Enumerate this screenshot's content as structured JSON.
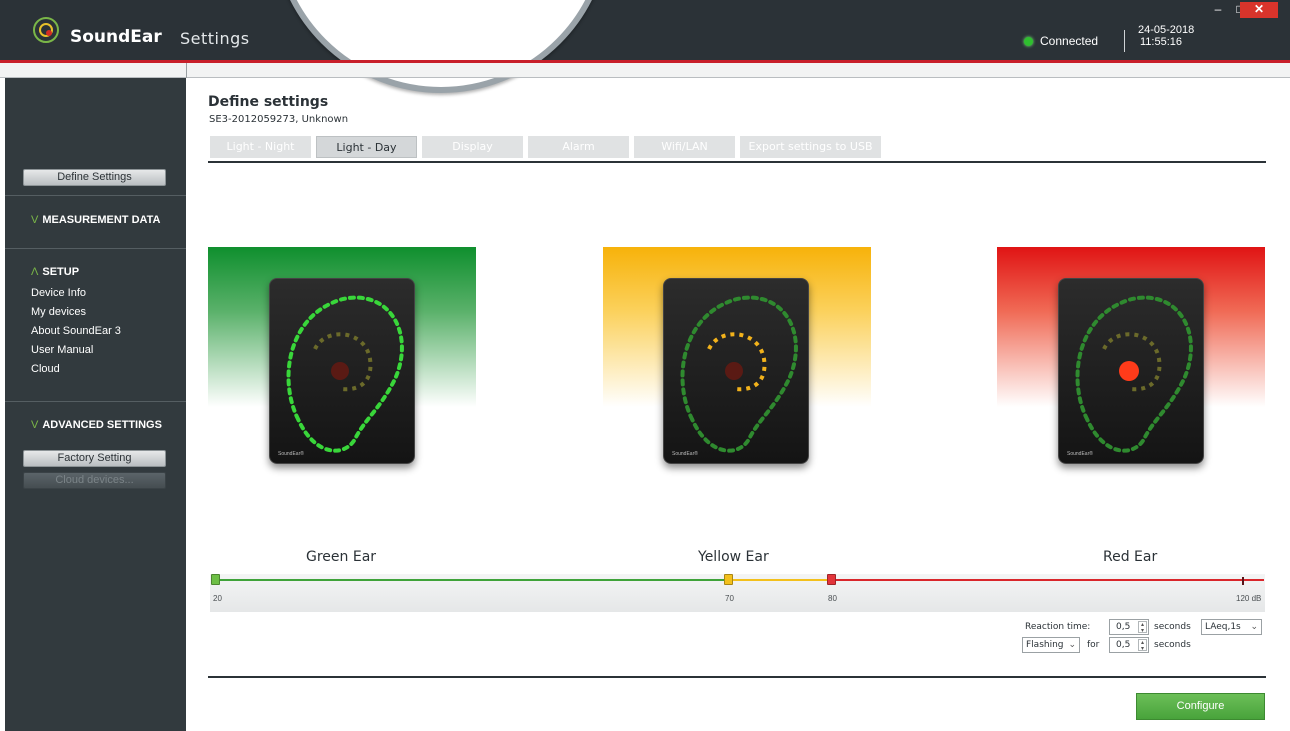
{
  "app": {
    "brand": "SoundEar",
    "brand_sub": "Settings",
    "status": "Connected",
    "date": "24-05-2018",
    "time": "11:55:16",
    "accent_color": "#c8202a"
  },
  "window_controls": {
    "minimize": "–",
    "maximize": "□",
    "close": "✕"
  },
  "sidebar": {
    "define_settings_button": "Define Settings",
    "measurement_data": {
      "chevron": "V",
      "label": "MEASUREMENT DATA"
    },
    "setup": {
      "chevron": "Λ",
      "label": "SETUP",
      "items": [
        "Device Info",
        "My devices",
        "About SoundEar 3",
        "User Manual",
        "Cloud"
      ]
    },
    "advanced_settings": {
      "chevron": "V",
      "label": "ADVANCED SETTINGS"
    },
    "factory_setting_button": "Factory Setting",
    "cloud_devices_button": "Cloud devices..."
  },
  "main": {
    "title": "Define settings",
    "subtitle": "SE3-2012059273, Unknown",
    "tabs": [
      {
        "label": "Light - Night",
        "active": false
      },
      {
        "label": "Light - Day",
        "active": true
      },
      {
        "label": "Display",
        "active": false
      },
      {
        "label": "Alarm",
        "active": false
      },
      {
        "label": "Wifi/LAN",
        "active": false
      },
      {
        "label": "Export settings to USB",
        "active": false
      }
    ],
    "ears": [
      {
        "label": "Green Ear",
        "color": "#0f8f2e",
        "device_brand": "SoundEar®"
      },
      {
        "label": "Yellow Ear",
        "color": "#f7b20a",
        "device_brand": "SoundEar®"
      },
      {
        "label": "Red Ear",
        "color": "#e01414",
        "device_brand": "SoundEar®"
      }
    ],
    "slider": {
      "min_label": "20",
      "yellow_label": "70",
      "red_label": "80",
      "max_label": "120 dB",
      "min": 20,
      "yellow_threshold": 70,
      "red_threshold": 80,
      "max": 120
    },
    "reaction_time_label": "Reaction time:",
    "reaction_time_value": "0,5",
    "seconds_label": "seconds",
    "measure_select": "LAeq,1s",
    "mode_select": "Flashing",
    "for_label": "for",
    "for_value": "0,5",
    "seconds_label_2": "seconds",
    "configure_button": "Configure"
  }
}
